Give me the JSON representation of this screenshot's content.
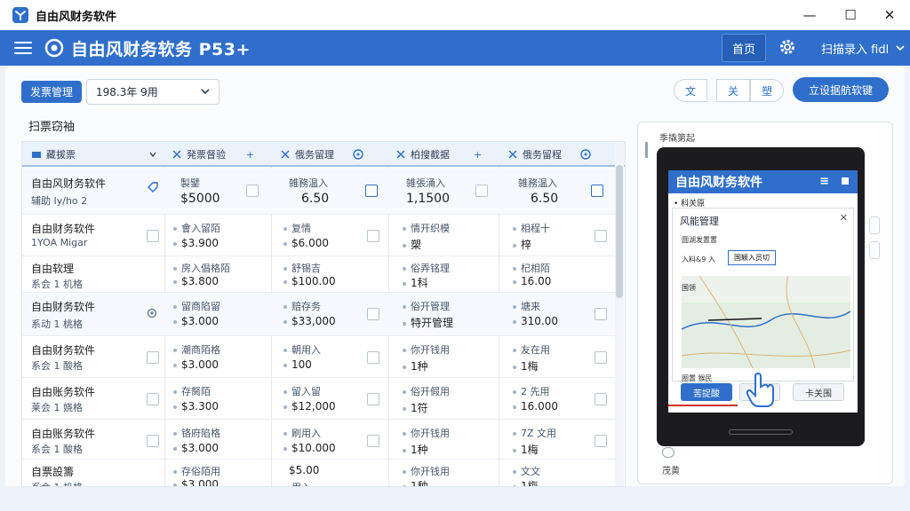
{
  "window": {
    "title": "自由风财务软件",
    "min": "—",
    "max": "☐",
    "close": "✕"
  },
  "appbar": {
    "title": "自由风财务软务 P53+",
    "home_label": "首页",
    "scan_label": "扫描录入 fidl"
  },
  "toolbar": {
    "tag_label": "发票管理",
    "period_value": "198.3年 9用",
    "btn1": "文",
    "btn2": "关",
    "btn3": "塑",
    "primary_label": "立设据航软键"
  },
  "section_title": "扫票窃袖",
  "table": {
    "headers": [
      "藏拔票",
      "発票督验",
      "+",
      "俄务留理",
      "",
      "柏搜截据",
      "+",
      "俄务留程",
      ""
    ],
    "rows": [
      {
        "name": "自由风财务软件",
        "name_sub": "辅助 Iy/ho 2",
        "c1_label": "製鐾",
        "c1_value": "$5000",
        "c2_label": "雑務温入",
        "c2_value": "6.50",
        "c3_label": "雑張涌入",
        "c3_value": "1,1500",
        "c4_label": "雑務温入",
        "c4_value": "6.50"
      },
      {
        "name": "自由财务软件",
        "name_sub": "1YOA Migar",
        "c1_label": "會入留陌",
        "c1_value": "$3.900",
        "c2_label": "复情",
        "c2_value": "$6.000",
        "c3_label": "情开织模",
        "c3_value": "槊",
        "c4_label": "相程十",
        "c4_value": "梓"
      },
      {
        "name": "自由软理",
        "name_sub": "系会 1 机格",
        "c1_label": "房入倡格陌",
        "c1_value": "$3.800",
        "c2_label": "舒锡吉",
        "c2_value": "$100.00",
        "c3_label": "俗弄铭理",
        "c3_value": "1科",
        "c4_label": "杞相陌",
        "c4_value": "16.00"
      },
      {
        "name": "自由财务软件",
        "name_sub": "系动 1 桃格",
        "c1_label": "留商陷留",
        "c1_value": "$3.000",
        "c2_label": "赔存务",
        "c2_value": "$33,000",
        "c3_label": "俗开管理",
        "c3_value": "特开管理",
        "c4_label": "塘来",
        "c4_value": "310.00"
      },
      {
        "name": "自由财务软件",
        "name_sub": "系会 1 酸格",
        "c1_label": "潮商陌格",
        "c1_value": "$3.000",
        "c2_label": "朝用入",
        "c2_value": "100",
        "c3_label": "你开钱用",
        "c3_value": "1种",
        "c4_label": "友在用",
        "c4_value": "1梅"
      },
      {
        "name": "自由账务软件",
        "name_sub": "莱会 1 娆格",
        "c1_label": "存胬陌",
        "c1_value": "$3.300",
        "c2_label": "留入留",
        "c2_value": "$12,000",
        "c3_label": "俗开假用",
        "c3_value": "1符",
        "c4_label": "2 先用",
        "c4_value": "16.000"
      },
      {
        "name": "自由账务软件",
        "name_sub": "系会 1 酸格",
        "c1_label": "铬府陷格",
        "c1_value": "$3.000",
        "c2_label": "刷用入",
        "c2_value": "$10.000",
        "c3_label": "你开钱用",
        "c3_value": "1种",
        "c4_label": "7Z 文用",
        "c4_value": "1梅"
      },
      {
        "name": "自票設籌",
        "name_sub": "系会 1 机格",
        "c1_label": "存俗陌用",
        "c1_value": "$3.000",
        "c2_label": "$5.00",
        "c2_value": "用入",
        "c3_label": "你开钱用",
        "c3_value": "1种",
        "c4_label": "文文",
        "c4_value": "1梅"
      }
    ]
  },
  "preview": {
    "top_label": "季撬第起",
    "bottom_label": "茂黄",
    "app_title": "自由风财务软件",
    "breadcrumb": "• 科关原",
    "dialog_title": "风能管理",
    "line1": "圆湖发置置",
    "line2": "入料&9 入",
    "callout": "国颖入员切",
    "line3": "国领",
    "line4": "圈置 猴民",
    "btn_confirm": "苦捉酸",
    "btn_cancel": "卡关围"
  },
  "colors": {
    "accent": "#2f6fcb",
    "accent_dark": "#2560b6",
    "panel": "#ffffff"
  }
}
